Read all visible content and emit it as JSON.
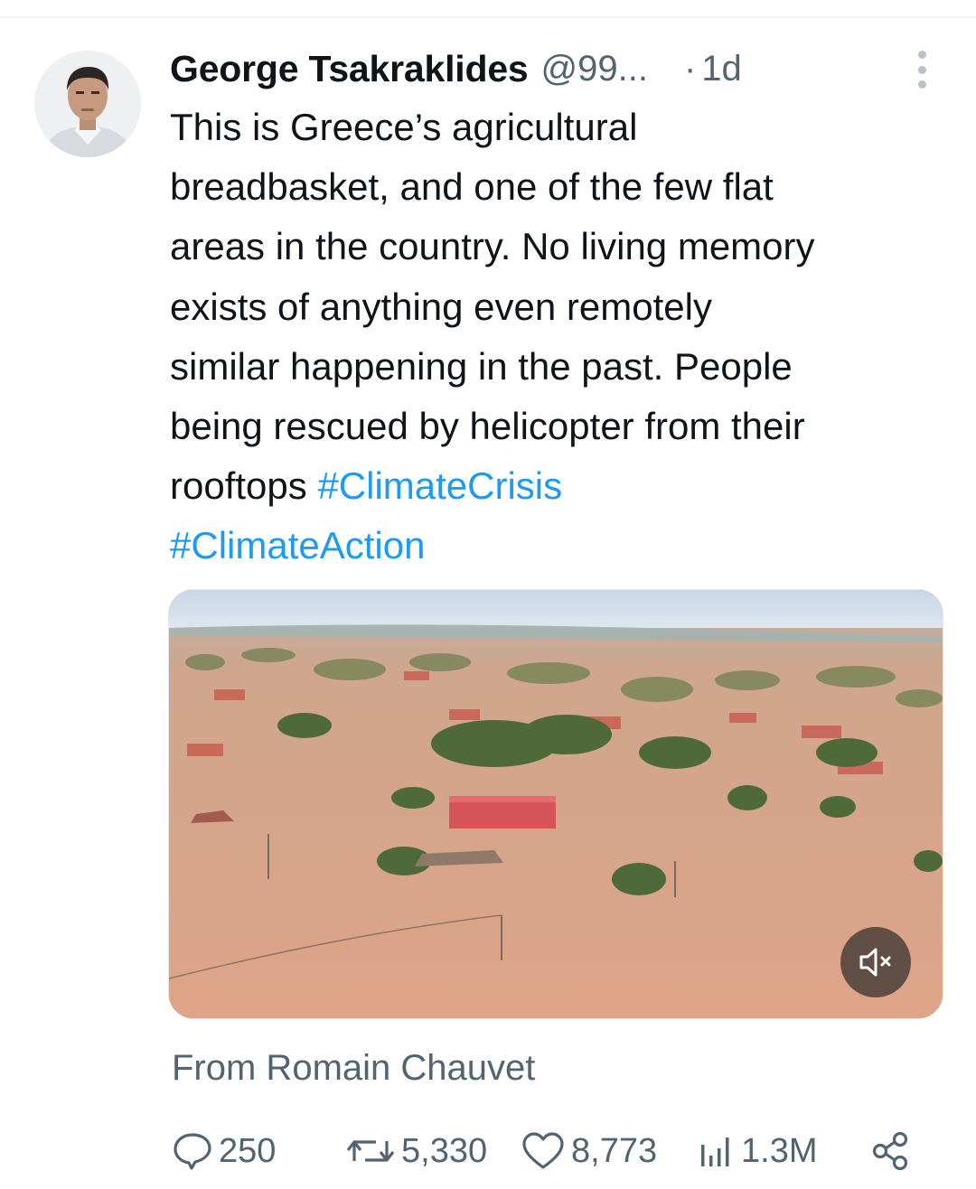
{
  "tweet": {
    "author_name": "George Tsakraklides",
    "author_handle": "@99...",
    "separator": "·",
    "time": "1d",
    "text_lines": [
      "This is Greece’s agricultural",
      "breadbasket, and one of the few flat",
      "areas in the country. No living memory",
      "exists of anything even remotely",
      "similar happening in the past. People",
      "being rescued by helicopter from their",
      "rooftops "
    ],
    "hashtags": [
      "#ClimateCrisis",
      "#ClimateAction"
    ],
    "media_caption": "From Romain Chauvet"
  },
  "actions": {
    "replies": "250",
    "reposts": "5,330",
    "likes": "8,773",
    "views": "1.3M"
  },
  "icons": {
    "more": "more-vertical-icon",
    "mute": "speaker-muted-icon",
    "reply": "reply-icon",
    "repost": "repost-icon",
    "like": "heart-icon",
    "views": "views-bar-chart-icon",
    "share": "share-icon"
  },
  "colors": {
    "text": "#0f1419",
    "secondary": "#536471",
    "link": "#1d9bf0",
    "floodwater": "#d9a283"
  }
}
